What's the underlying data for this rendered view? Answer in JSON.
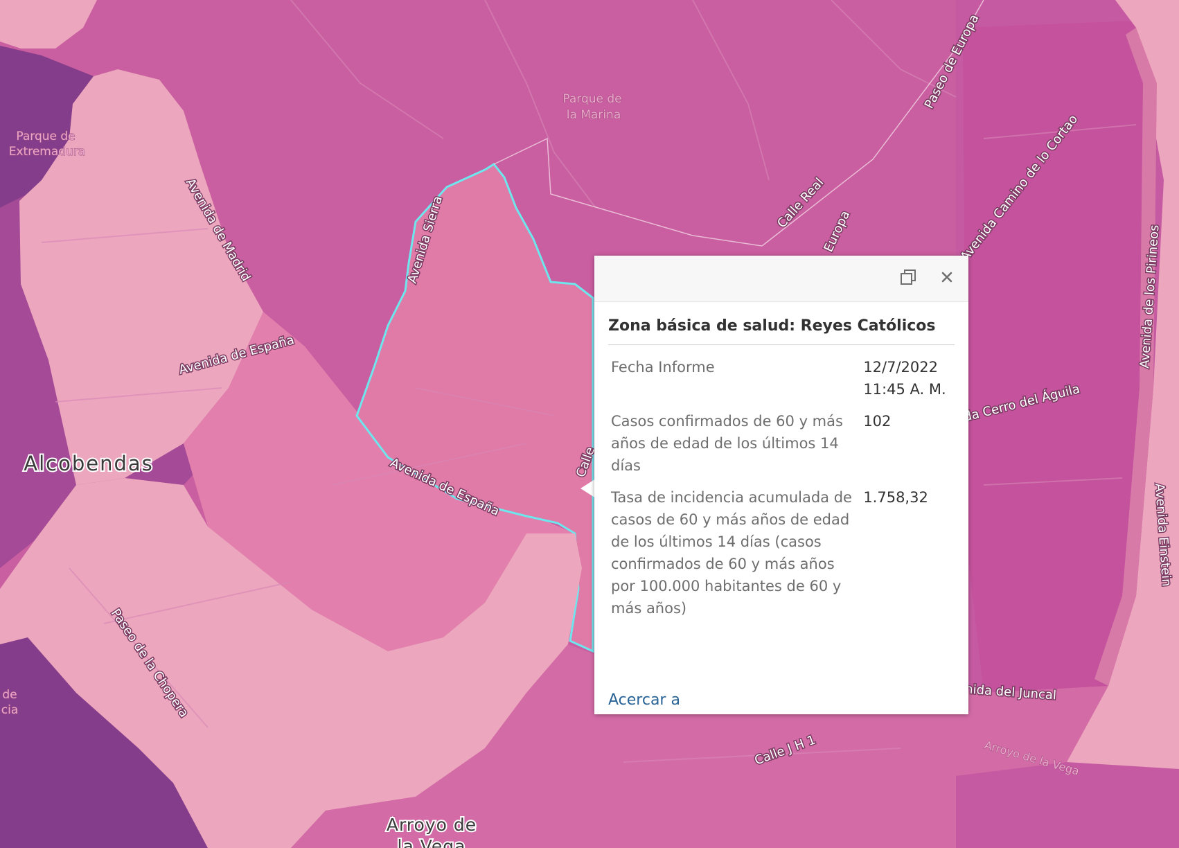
{
  "map": {
    "labels": {
      "alcobendas": "Alcobendas",
      "arroyo_de": "Arroyo de",
      "la_vega": "la Vega",
      "parque_marina_1": "Parque de",
      "parque_marina_2": "la Marina",
      "parque_extremadura_1": "Parque de",
      "parque_extremadura_2": "Extremadura",
      "de": "de",
      "cia": "cia"
    },
    "streets": {
      "avenida_sierra": "Avenida Sierra",
      "avenida_madrid": "Avenida de Madrid",
      "avenida_espana_1": "Avenida de España",
      "avenida_espana_2": "Avenida de España",
      "paseo_chopera": "Paseo de la Chopera",
      "paseo_europa": "Paseo de Europa",
      "europa": "Europa",
      "calle_real": "Calle Real",
      "camino_cortao": "Avenida Camino de lo Cortao",
      "avenida_pirineos": "Avenida de los Pirineos",
      "cerro_aguila": "Avenida Cerro del Águila",
      "avenida_einstein": "Avenida Einstein",
      "avenida_juncal": "Avenida del Juncal",
      "calle_jh1": "Calle J H 1",
      "arroyo_vega": "Arroyo de la Vega",
      "calle": "Calle"
    },
    "colors": {
      "lightest": "#eca6bd",
      "light": "#e27fac",
      "medium": "#c95ea0",
      "dark": "#a54a96",
      "darkest": "#843d8a",
      "highlight": "#6ee6ee"
    }
  },
  "popup": {
    "title": "Zona básica de salud: Reyes Católicos",
    "rows": [
      {
        "name": "Fecha Informe",
        "value": "12/7/2022 11:45 A. M."
      },
      {
        "name": "Casos confirmados de 60 y más años de edad de los últimos 14 días",
        "value": "102"
      },
      {
        "name": "Tasa de incidencia acumulada de casos de 60 y más años de edad de los últimos 14 días (casos confirmados de 60 y más años por 100.000 habitantes de 60 y más años)",
        "value": "1.758,32"
      }
    ],
    "zoom_link": "Acercar a",
    "icons": {
      "dock": "dock-icon",
      "close": "close-icon"
    }
  }
}
